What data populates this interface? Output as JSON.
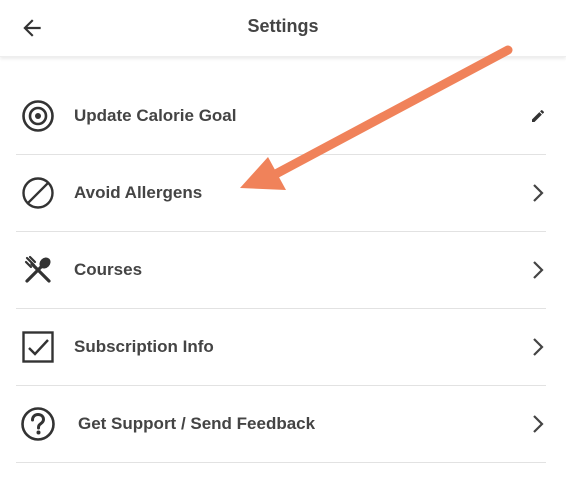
{
  "header": {
    "title": "Settings",
    "back_icon": "arrow-left-icon"
  },
  "settings": {
    "items": [
      {
        "label": "Update Calorie Goal",
        "icon": "target-icon",
        "trailing": "pencil-icon"
      },
      {
        "label": "Avoid Allergens",
        "icon": "prohibited-icon",
        "trailing": "chevron-right-icon"
      },
      {
        "label": "Courses",
        "icon": "fork-spoon-icon",
        "trailing": "chevron-right-icon"
      },
      {
        "label": "Subscription Info",
        "icon": "checkbox-icon",
        "trailing": "chevron-right-icon"
      },
      {
        "label": "Get Support / Send Feedback",
        "icon": "help-circle-icon",
        "trailing": "chevron-right-icon"
      }
    ]
  },
  "annotation": {
    "type": "arrow",
    "color": "#f0825a",
    "points_to": "Avoid Allergens"
  },
  "colors": {
    "text": "#444444",
    "divider": "#e2e2e2",
    "icon": "#333333"
  }
}
